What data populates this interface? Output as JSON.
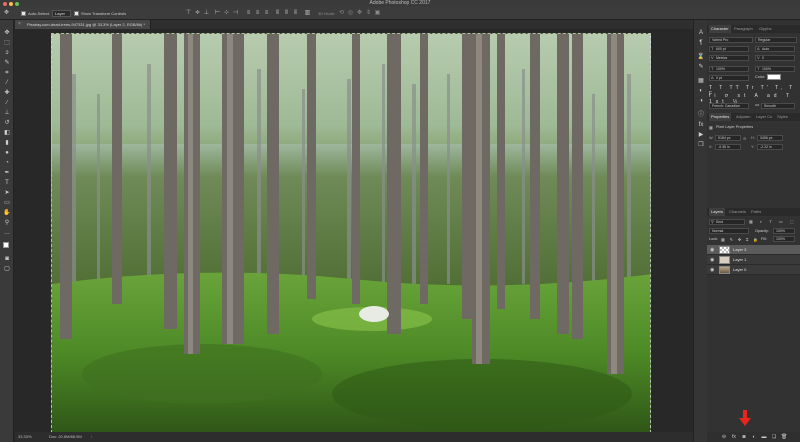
{
  "window": {
    "title": "Adobe Photoshop CC 2017"
  },
  "options_bar": {
    "auto_select_label": "Auto-Select:",
    "auto_select_value": "Layer",
    "show_transform_label": "Show Transform Controls",
    "mode_3d_label": "3D Mode:"
  },
  "document": {
    "tab_label": "Pixabay.com-dead-trees-947331.jpg @ 33.3% (Layer 2, RGB/8#) *"
  },
  "status": {
    "zoom": "33.33%",
    "doc_size": "Doc: 20.6M/68.9M"
  },
  "character_panel": {
    "tabs": [
      "Character",
      "Paragraph",
      "Glyphs"
    ],
    "font_family": "Varied Pro",
    "font_style": "Regular",
    "font_size": "600 pt",
    "leading": "Auto",
    "kerning": "Metrics",
    "tracking": "0",
    "vertical_scale": "100%",
    "horizontal_scale": "100%",
    "baseline_shift": "0 pt",
    "color_label": "Color:",
    "color": "#ffffff",
    "language": "French: Canadian",
    "antialias_label": "aa",
    "antialias": "Smooth"
  },
  "properties_panel": {
    "tabs": [
      "Properties",
      "Adjustm",
      "Layer Co",
      "Styles"
    ],
    "section_title": "Pixel Layer Properties",
    "w_label": "W:",
    "w_value": "5184 px",
    "h_label": "H:",
    "h_value": "3456 px",
    "x_label": "X:",
    "x_value": "-9.35 in",
    "y_label": "Y:",
    "y_value": "-2.22 in"
  },
  "layers_panel": {
    "tabs": [
      "Layers",
      "Channels",
      "Paths"
    ],
    "filter_value": "Kind",
    "blend_mode": "Normal",
    "opacity_label": "Opacity:",
    "opacity": "100%",
    "lock_label": "Lock:",
    "fill_label": "Fill:",
    "fill": "100%",
    "layers": [
      {
        "name": "Layer 3",
        "selected": true
      },
      {
        "name": "Layer 1",
        "selected": false
      },
      {
        "name": "Layer 0",
        "selected": false
      }
    ]
  },
  "colors": {
    "accent_red": "#e8261c",
    "panel_bg": "#323232",
    "canvas_bg": "#282828"
  }
}
